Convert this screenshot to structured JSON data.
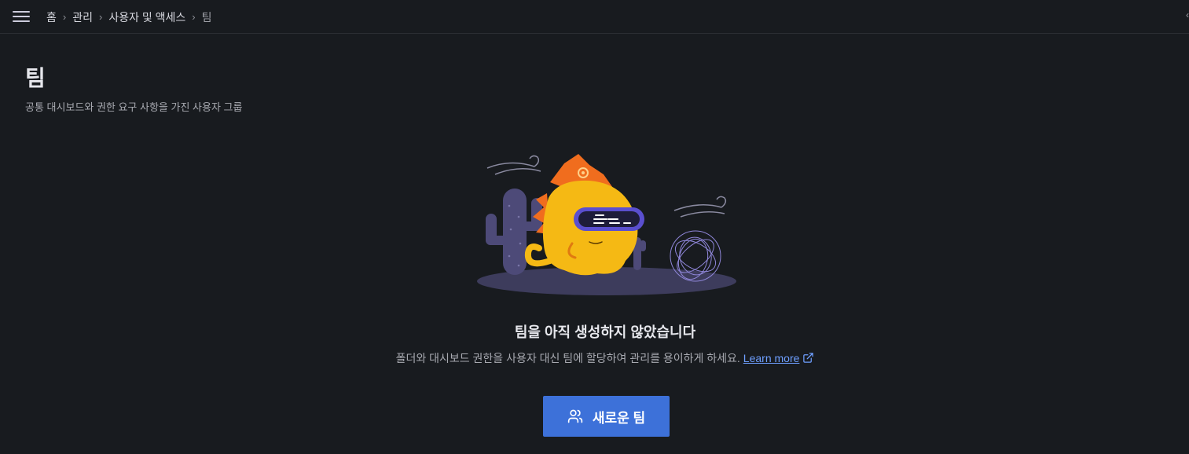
{
  "breadcrumb": {
    "items": [
      "홈",
      "관리",
      "사용자 및 액세스",
      "팀"
    ]
  },
  "page": {
    "title": "팀",
    "subtitle": "공통 대시보드와 권한 요구 사항을 가진 사용자 그룹"
  },
  "empty_state": {
    "title": "팀을 아직 생성하지 않았습니다",
    "description": "폴더와 대시보드 권한을 사용자 대신 팀에 할당하여 관리를 용이하게 하세요.",
    "learn_more": "Learn more",
    "button_label": "새로운 팀",
    "button_icon": "users-icon"
  },
  "colors": {
    "background": "#181b1f",
    "primary_button": "#3d71d9",
    "link": "#6e9fff",
    "mascot_body": "#f5b914",
    "mascot_crest": "#f06d1e",
    "visor": "#5a4fcf",
    "cactus": "#4d4a78"
  }
}
